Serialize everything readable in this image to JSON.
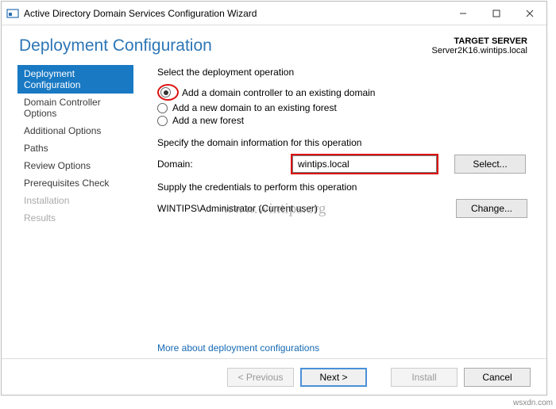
{
  "window": {
    "title": "Active Directory Domain Services Configuration Wizard"
  },
  "header": {
    "title": "Deployment Configuration",
    "target_label": "TARGET SERVER",
    "target_server": "Server2K16.wintips.local"
  },
  "sidebar": {
    "items": [
      {
        "label": "Deployment Configuration",
        "selected": true,
        "disabled": false
      },
      {
        "label": "Domain Controller Options",
        "selected": false,
        "disabled": false
      },
      {
        "label": "Additional Options",
        "selected": false,
        "disabled": false
      },
      {
        "label": "Paths",
        "selected": false,
        "disabled": false
      },
      {
        "label": "Review Options",
        "selected": false,
        "disabled": false
      },
      {
        "label": "Prerequisites Check",
        "selected": false,
        "disabled": false
      },
      {
        "label": "Installation",
        "selected": false,
        "disabled": true
      },
      {
        "label": "Results",
        "selected": false,
        "disabled": true
      }
    ]
  },
  "content": {
    "select_op_label": "Select the deployment operation",
    "radios": [
      {
        "label": "Add a domain controller to an existing domain",
        "checked": true
      },
      {
        "label": "Add a new domain to an existing forest",
        "checked": false
      },
      {
        "label": "Add a new forest",
        "checked": false
      }
    ],
    "specify_label": "Specify the domain information for this operation",
    "domain_label": "Domain:",
    "domain_value": "wintips.local",
    "select_btn": "Select...",
    "supply_label": "Supply the credentials to perform this operation",
    "credentials_user": "WINTIPS\\Administrator (Current user)",
    "change_btn": "Change...",
    "more_link": "More about deployment configurations"
  },
  "footer": {
    "previous": "< Previous",
    "next": "Next >",
    "install": "Install",
    "cancel": "Cancel"
  },
  "watermark": "www.wintips.org",
  "attribution": "wsxdn.com"
}
